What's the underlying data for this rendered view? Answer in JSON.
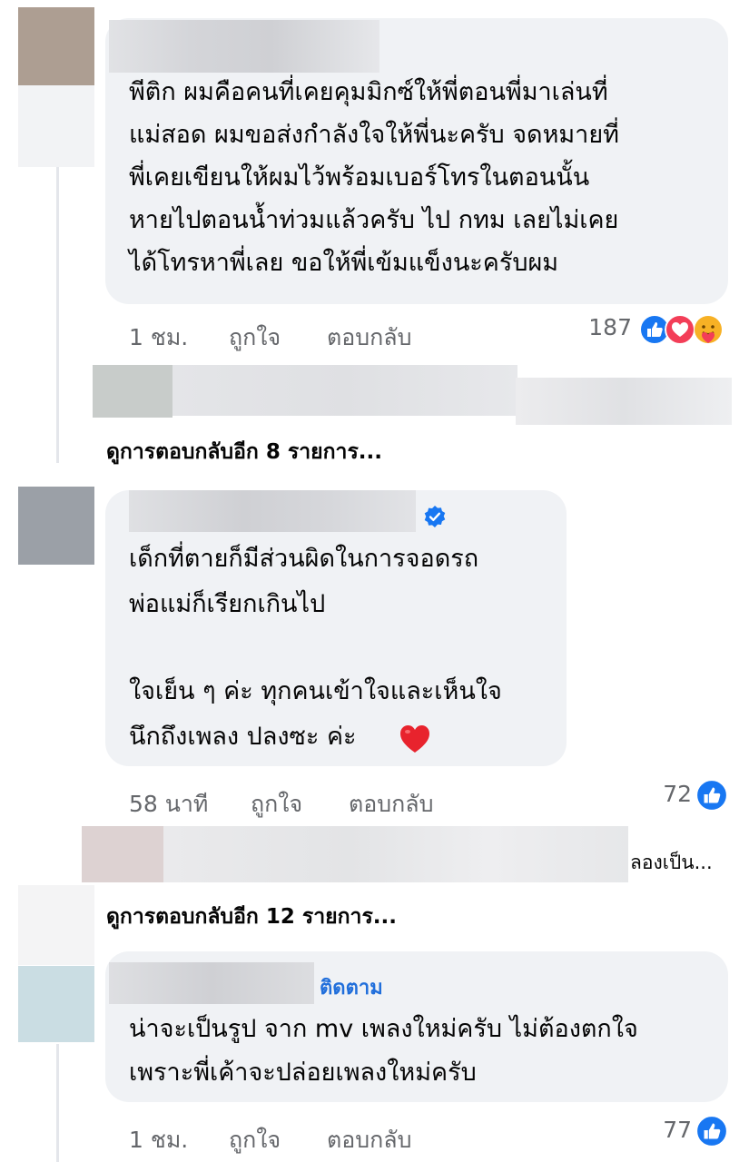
{
  "comments": [
    {
      "lines": [
        "พีติก ผมคือคนที่เคยคุมมิกซ์ให้พี่ตอนพี่มาเล่นที่",
        "แม่สอด ผมขอส่งกำลังใจให้พี่นะครับ จดหมายที่",
        "พี่เคยเขียนให้ผมไว้พร้อมเบอร์โทรในตอนนั้น",
        "หายไปตอนน้ำท่วมแล้วครับ ไป กทม เลยไม่เคย",
        "ได้โทรหาพี่เลย ขอให้พี่เข้มแข็งนะครับผม"
      ],
      "time": "1 ชม.",
      "like": "ถูกใจ",
      "reply": "ตอบกลับ",
      "reaction_count": "187",
      "reactions": [
        "like-icon",
        "love-icon",
        "care-icon"
      ]
    },
    {
      "lines": [
        "เด็กที่ตายก็มีส่วนผิดในการจอดรถ",
        "พ่อแม่ก็เรียกเกินไป",
        "ใจเย็น ๆ ค่ะ ทุกคนเข้าใจและเห็นใจ",
        "นึกถึงเพลง ปลงซะ ค่ะ"
      ],
      "emoji": "red-heart-emoji",
      "time": "58 นาที",
      "like": "ถูกใจ",
      "reply": "ตอบกลับ",
      "reaction_count": "72",
      "reactions": [
        "like-icon"
      ]
    },
    {
      "follow": "ติดตาม",
      "lines": [
        "น่าจะเป็นรูป จาก mv เพลงใหม่ครับ ไม่ต้องตกใจ",
        "เพราะพี่เค้าจะปล่อยเพลงใหม่ครับ"
      ],
      "time": "1 ชม.",
      "like": "ถูกใจ",
      "reply": "ตอบกลับ",
      "reaction_count": "77",
      "reactions": [
        "like-icon"
      ]
    }
  ],
  "more_replies": [
    "ดูการตอบกลับอีก 8 รายการ...",
    "ดูการตอบกลับอีก 12 รายการ..."
  ],
  "reply_preview_text": "ลองเป็น...",
  "colors": {
    "bubble": "#f0f2f5",
    "meta": "#65676b",
    "like_blue": "#1877f2",
    "love_red": "#f33e58",
    "care_yellow": "#f7b125",
    "follow_blue": "#216fdb"
  }
}
